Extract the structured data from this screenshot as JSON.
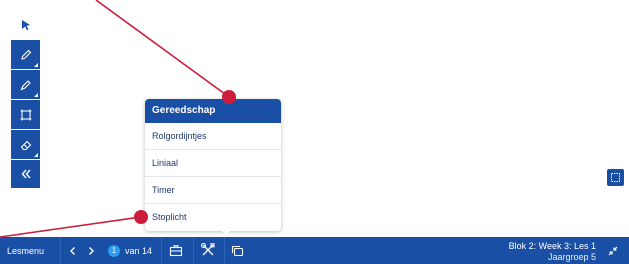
{
  "colors": {
    "primary": "#1a4fa6",
    "badge": "#2d9cf0",
    "annotation": "#cc1d3a",
    "text_dark": "#1f3a68"
  },
  "toolbar": {
    "tools": [
      {
        "icon": "cursor-arrow-icon"
      },
      {
        "icon": "pencil-icon"
      },
      {
        "icon": "marker-icon"
      },
      {
        "icon": "crop-frame-icon"
      },
      {
        "icon": "eraser-icon"
      },
      {
        "icon": "double-chevron-left-icon"
      }
    ]
  },
  "popup": {
    "title": "Gereedschap",
    "items": [
      "Rolgordijntjes",
      "Liniaal",
      "Timer",
      "Stoplicht"
    ]
  },
  "bottombar": {
    "menu_label": "Lesmenu",
    "current_page": "1",
    "page_total": "van 14",
    "lesson_title": "Blok 2: Week 3: Les 1",
    "group": "Jaargroep 5"
  }
}
